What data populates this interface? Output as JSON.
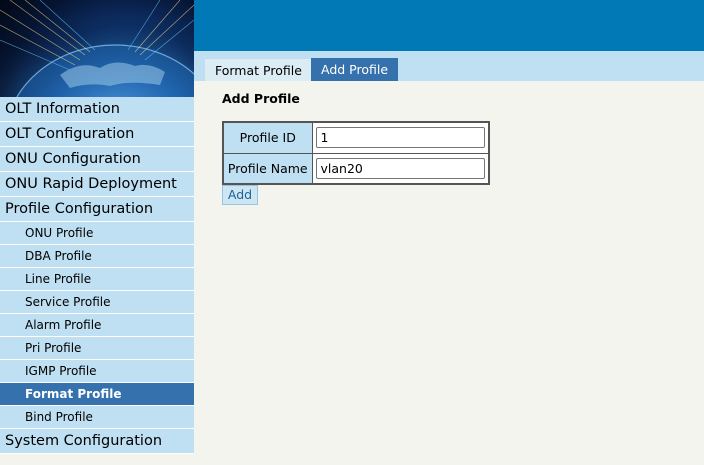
{
  "sidebar": {
    "items": [
      {
        "label": "OLT Information"
      },
      {
        "label": "OLT Configuration"
      },
      {
        "label": "ONU Configuration"
      },
      {
        "label": "ONU Rapid Deployment"
      },
      {
        "label": "Profile Configuration"
      }
    ],
    "profile_sub": [
      {
        "label": "ONU Profile"
      },
      {
        "label": "DBA Profile"
      },
      {
        "label": "Line Profile"
      },
      {
        "label": "Service Profile"
      },
      {
        "label": "Alarm Profile"
      },
      {
        "label": "Pri Profile"
      },
      {
        "label": "IGMP Profile"
      },
      {
        "label": "Format Profile",
        "active": true
      },
      {
        "label": "Bind Profile"
      }
    ],
    "after": [
      {
        "label": "System Configuration"
      }
    ]
  },
  "tabs": [
    {
      "label": "Format Profile"
    },
    {
      "label": "Add Profile",
      "active": true
    }
  ],
  "main": {
    "title": "Add Profile",
    "fields": {
      "profile_id": {
        "label": "Profile ID",
        "value": "1"
      },
      "profile_name": {
        "label": "Profile Name",
        "value": "vlan20"
      }
    },
    "add_button": "Add"
  },
  "colors": {
    "topbar": "#0079b6",
    "nav_bg": "#bfe0f2",
    "active": "#3471ad",
    "content_bg": "#f4f4ee"
  }
}
